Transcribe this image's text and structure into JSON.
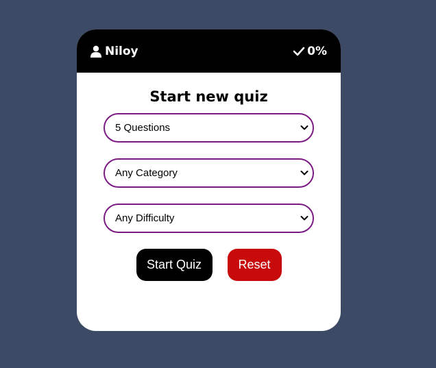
{
  "header": {
    "username": "Niloy",
    "score": "0%"
  },
  "quiz": {
    "title": "Start new quiz",
    "questions_select": "5 Questions",
    "category_select": "Any Category",
    "difficulty_select": "Any Difficulty",
    "start_label": "Start Quiz",
    "reset_label": "Reset"
  },
  "colors": {
    "background": "#3d4a66",
    "header": "#000000",
    "select_border": "#7b1a83",
    "reset_button": "#c90a0a"
  },
  "icons": {
    "user": "user-icon",
    "score": "check-icon",
    "dropdown": "chevron-down-icon"
  }
}
